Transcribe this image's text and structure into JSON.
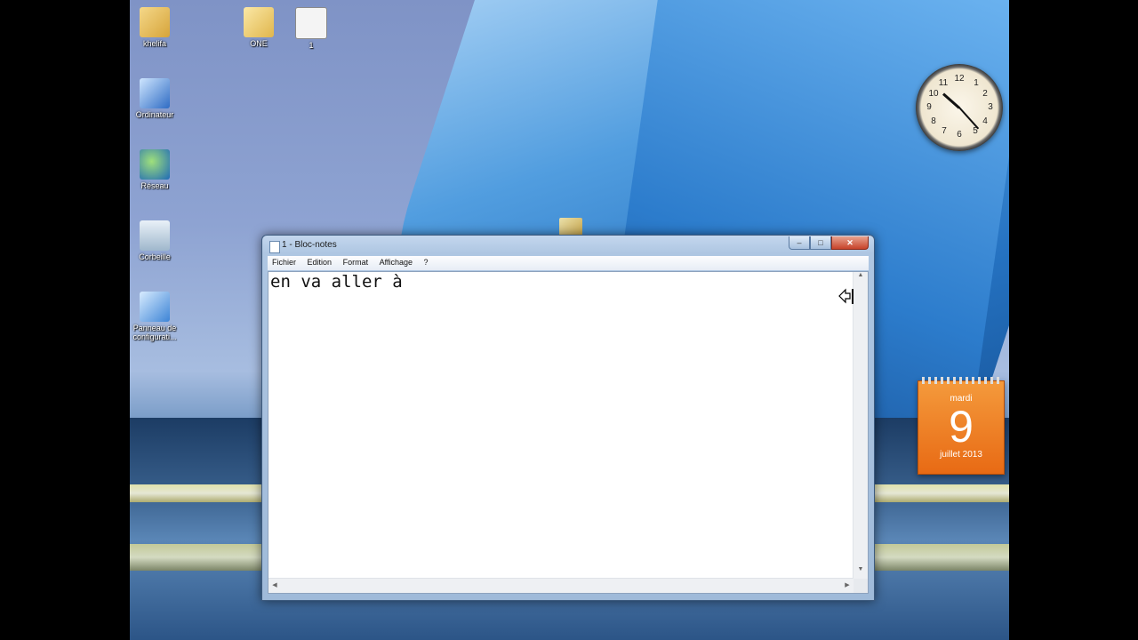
{
  "desktop": {
    "icons": [
      {
        "label": "khelifa",
        "icon": "user-folder-icon"
      },
      {
        "label": "ONE",
        "icon": "folder-icon"
      },
      {
        "label": "1",
        "icon": "text-file-icon"
      },
      {
        "label": "Ordinateur",
        "icon": "computer-icon"
      },
      {
        "label": "Réseau",
        "icon": "network-icon"
      },
      {
        "label": "Corbeille",
        "icon": "recycle-bin-icon"
      },
      {
        "label": "Panneau de configurati...",
        "icon": "control-panel-icon"
      }
    ]
  },
  "clock_gadget": {
    "numbers": [
      "12",
      "1",
      "2",
      "3",
      "4",
      "5",
      "6",
      "7",
      "8",
      "9",
      "10",
      "11"
    ],
    "time": "10:23"
  },
  "calendar_gadget": {
    "weekday": "mardi",
    "day": "9",
    "month_year": "juillet 2013"
  },
  "notepad": {
    "title": "1 - Bloc-notes",
    "menu": [
      "Fichier",
      "Edition",
      "Format",
      "Affichage",
      "?"
    ],
    "content": "en va aller à",
    "controls": {
      "minimize": "–",
      "maximize": "□",
      "close": "✕"
    }
  },
  "colors": {
    "calendar_orange": "#e86a14",
    "window_frame": "#aec6e2",
    "close_button": "#c7432a"
  }
}
